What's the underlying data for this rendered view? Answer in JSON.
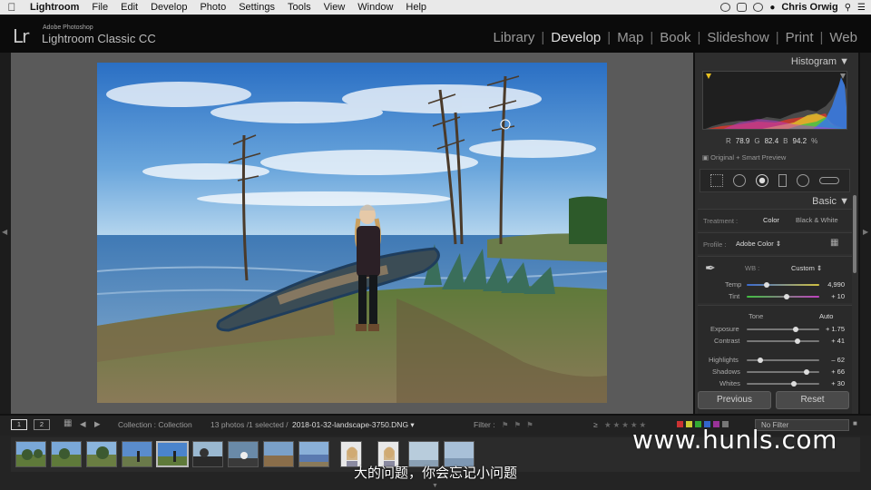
{
  "menubar": {
    "app_name": "Lightroom",
    "items": [
      "File",
      "Edit",
      "Develop",
      "Photo",
      "Settings",
      "Tools",
      "View",
      "Window",
      "Help"
    ],
    "user": "Chris Orwig"
  },
  "identity_plate": {
    "logo": "Lr",
    "small_text": "Adobe Photoshop",
    "large_text": "Lightroom Classic CC"
  },
  "modules": [
    "Library",
    "Develop",
    "Map",
    "Book",
    "Slideshow",
    "Print",
    "Web"
  ],
  "active_module": "Develop",
  "histogram": {
    "title": "Histogram",
    "r_label": "R",
    "r_value": "78.9",
    "g_label": "G",
    "g_value": "82.4",
    "b_label": "B",
    "b_value": "94.2",
    "unit": "%",
    "preview_label": "Original + Smart Preview"
  },
  "basic": {
    "title": "Basic",
    "treatment_label": "Treatment :",
    "treatment_color": "Color",
    "treatment_bw": "Black & White",
    "profile_label": "Profile :",
    "profile_value": "Adobe Color",
    "wb_label": "WB :",
    "wb_value": "Custom",
    "tone_label": "Tone",
    "auto_label": "Auto",
    "sliders": [
      {
        "label": "Temp",
        "value": "4,990",
        "pos": 0.28
      },
      {
        "label": "Tint",
        "value": "+ 10",
        "pos": 0.55
      },
      {
        "label": "Exposure",
        "value": "+ 1.75",
        "pos": 0.67
      },
      {
        "label": "Contrast",
        "value": "+ 41",
        "pos": 0.7
      },
      {
        "label": "Highlights",
        "value": "– 62",
        "pos": 0.19
      },
      {
        "label": "Shadows",
        "value": "+ 66",
        "pos": 0.83
      },
      {
        "label": "Whites",
        "value": "+ 30",
        "pos": 0.65
      }
    ]
  },
  "buttons": {
    "previous": "Previous",
    "reset": "Reset"
  },
  "filmstrip_bar": {
    "page1": "1",
    "page2": "2",
    "collection": "Collection : Collection",
    "count": "13 photos /1 selected /",
    "filename": "2018-01-32-landscape-3750.DNG",
    "filter_label": "Filter :",
    "no_filter": "No Filter"
  },
  "watermark": "www.hunls.com",
  "subtitle": "大的问题，你会忘记小问题",
  "colors": {
    "accent_text": "#e0e0e0",
    "panel_bg": "#2e2e2e",
    "canvas_bg": "#5a5a5a"
  }
}
